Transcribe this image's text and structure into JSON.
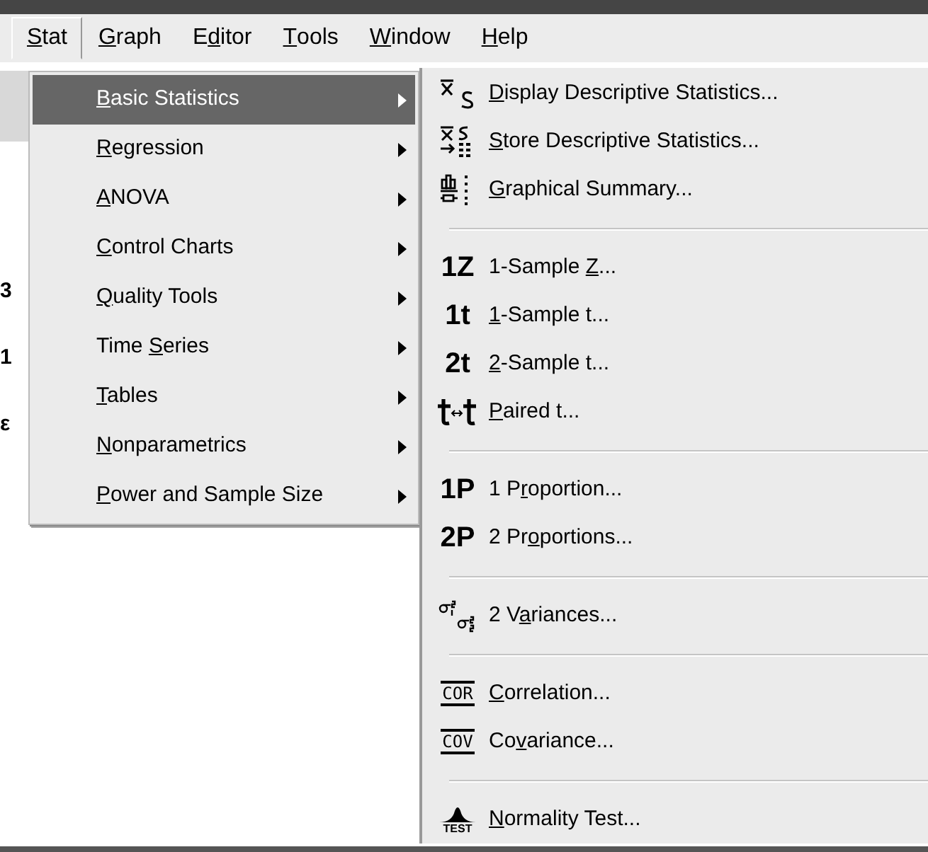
{
  "menubar": [
    {
      "key": "S",
      "post": "tat",
      "selected": true
    },
    {
      "key": "G",
      "post": "raph",
      "selected": false
    },
    {
      "pre": "E",
      "key": "d",
      "post": "itor",
      "selected": false
    },
    {
      "key": "T",
      "post": "ools",
      "selected": false
    },
    {
      "key": "W",
      "post": "indow",
      "selected": false
    },
    {
      "key": "H",
      "post": "elp",
      "selected": false
    }
  ],
  "background_text": [
    "3",
    "1",
    "ε"
  ],
  "stat_menu": [
    {
      "key": "B",
      "post": "asic Statistics",
      "selected": true
    },
    {
      "key": "R",
      "post": "egression",
      "selected": false
    },
    {
      "key": "A",
      "post": "NOVA",
      "selected": false
    },
    {
      "key": "C",
      "post": "ontrol Charts",
      "selected": false
    },
    {
      "key": "Q",
      "post": "uality Tools",
      "selected": false
    },
    {
      "pre": "Time ",
      "key": "S",
      "post": "eries",
      "selected": false
    },
    {
      "key": "T",
      "post": "ables",
      "selected": false
    },
    {
      "key": "N",
      "post": "onparametrics",
      "selected": false
    },
    {
      "key": "P",
      "post": "ower and Sample Size",
      "selected": false
    }
  ],
  "submenu": [
    {
      "kind": "xbar",
      "key": "D",
      "post": "isplay Descriptive Statistics..."
    },
    {
      "kind": "store",
      "key": "S",
      "post": "tore Descriptive Statistics..."
    },
    {
      "kind": "graph",
      "key": "G",
      "post": "raphical Summary..."
    },
    {
      "kind": "separator"
    },
    {
      "kind": "symbol",
      "badge": "1Z",
      "pre": "1-Sample ",
      "key": "Z",
      "post": "..."
    },
    {
      "kind": "symbol",
      "badge": "1t",
      "key": "1",
      "post": "-Sample t..."
    },
    {
      "kind": "symbol",
      "badge": "2t",
      "key": "2",
      "post": "-Sample t..."
    },
    {
      "kind": "paired",
      "key": "P",
      "post": "aired t..."
    },
    {
      "kind": "separator"
    },
    {
      "kind": "symbol",
      "badge": "1P",
      "pre": "1 P",
      "key": "r",
      "post": "oportion..."
    },
    {
      "kind": "symbol",
      "badge": "2P",
      "pre": "2 Pr",
      "key": "o",
      "post": "portions..."
    },
    {
      "kind": "separator"
    },
    {
      "kind": "variance",
      "pre": "2 V",
      "key": "a",
      "post": "riances..."
    },
    {
      "kind": "separator"
    },
    {
      "kind": "boxed",
      "badge": "COR",
      "key": "C",
      "post": "orrelation..."
    },
    {
      "kind": "boxed",
      "badge": "COV",
      "pre": "Co",
      "key": "v",
      "post": "ariance..."
    },
    {
      "kind": "separator"
    },
    {
      "kind": "test",
      "badge": "TEST",
      "key": "N",
      "post": "ormality Test..."
    }
  ]
}
